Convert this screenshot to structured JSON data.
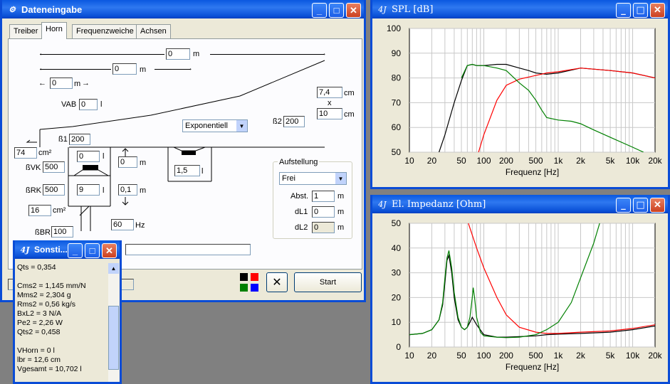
{
  "windows": {
    "input": {
      "title": "Dateneingabe",
      "tabs": [
        "Treiber",
        "Horn",
        "Frequenzweiche",
        "Achsen"
      ],
      "active_tab": "Horn",
      "fields": {
        "len_total": "0",
        "len_total_unit": "m",
        "len_2": "0",
        "len_2_unit": "m",
        "len_3": "0",
        "len_3_unit": "m",
        "vab_label": "VAB",
        "vab": "0",
        "vab_unit": "l",
        "w1": "7,4",
        "w1_unit": "cm",
        "times": "x",
        "w2": "10",
        "w2_unit": "cm",
        "beta2_label": "ß2",
        "beta2": "200",
        "horn_type": "Exponentiell",
        "beta1_label": "ß1",
        "beta1": "200",
        "area1": "74",
        "area1_unit": "cm²",
        "vol_l": "0",
        "vol_l_unit": "l",
        "bvk_label": "ßVK",
        "bvk": "500",
        "brk_label": "ßRK",
        "brk": "500",
        "dist1": "0",
        "dist1_unit": "m",
        "dist2": "0,1",
        "dist2_unit": "m",
        "vol2": "9",
        "vol2_unit": "l",
        "vol3": "1,5",
        "vol3_unit": "l",
        "area2": "16",
        "area2_unit": "cm²",
        "bbr_label": "ßBR",
        "bbr": "100",
        "freq": "60",
        "freq_unit": "Hz"
      },
      "aufstellung": {
        "legend": "Aufstellung",
        "mode": "Frei",
        "abst_label": "Abst.",
        "abst": "1",
        "abst_unit": "m",
        "dl1_label": "dL1",
        "dl1": "0",
        "dl1_unit": "m",
        "dl2_label": "dL2",
        "dl2": "0",
        "dl2_unit": "m"
      },
      "start_label": "Start",
      "colors": [
        "#000000",
        "#ff0000",
        "#008000",
        "#0000ff"
      ]
    },
    "sonst": {
      "title": "Sonsti...",
      "lines": [
        "Qts = 0,354",
        "",
        "Cms2 = 1,145 mm/N",
        "Mms2 = 2,304 g",
        "Rms2 = 0,56 kg/s",
        "BxL2 = 3 N/A",
        "Pe2 = 2,26 W",
        "Qts2 = 0,458",
        "",
        "VHorn = 0 l",
        "lbr = 12,6 cm",
        "Vgesamt = 10,702 l"
      ]
    },
    "spl": {
      "title": "SPL [dB]"
    },
    "imp": {
      "title": "El. Impedanz [Ohm]"
    }
  },
  "chart_data": [
    {
      "type": "line",
      "title": "SPL [dB]",
      "xlabel": "Frequenz [Hz]",
      "ylabel": "",
      "xscale": "log",
      "xlim": [
        10,
        20000
      ],
      "ylim": [
        50,
        100
      ],
      "xticks": [
        10,
        20,
        50,
        100,
        200,
        500,
        1000,
        2000,
        5000,
        10000,
        20000
      ],
      "xticklabels": [
        "10",
        "20",
        "50",
        "100",
        "200",
        "500",
        "1k",
        "2k",
        "5k",
        "10k",
        "20k"
      ],
      "yticks": [
        50,
        60,
        70,
        80,
        90,
        100
      ],
      "grid": true,
      "series": [
        {
          "color": "#000000",
          "x": [
            25,
            30,
            40,
            50,
            60,
            70,
            80,
            100,
            150,
            200,
            300,
            400,
            500,
            700,
            1000,
            2000,
            5000,
            10000,
            20000
          ],
          "y": [
            50,
            57,
            70,
            79,
            85,
            85.5,
            85,
            85,
            85.5,
            85.5,
            84,
            83,
            82,
            81.5,
            82,
            84,
            83,
            82,
            80
          ]
        },
        {
          "color": "#ff0000",
          "x": [
            85,
            100,
            150,
            200,
            300,
            500,
            700,
            1000,
            2000,
            5000,
            10000,
            20000
          ],
          "y": [
            50,
            57,
            71,
            77,
            79.5,
            81,
            82,
            82.5,
            84,
            83,
            82,
            80
          ]
        },
        {
          "color": "#008000",
          "x": [
            50,
            60,
            70,
            80,
            100,
            150,
            200,
            300,
            400,
            500,
            600,
            700,
            1000,
            1500,
            2000,
            3000,
            5000,
            10000,
            14000
          ],
          "y": [
            80,
            85,
            85.5,
            85,
            85,
            84,
            83,
            78,
            75,
            71,
            67,
            64,
            63,
            62.5,
            61.5,
            59,
            56,
            52,
            50
          ]
        }
      ]
    },
    {
      "type": "line",
      "title": "El. Impedanz [Ohm]",
      "xlabel": "Frequenz [Hz]",
      "ylabel": "",
      "xscale": "log",
      "xlim": [
        10,
        20000
      ],
      "ylim": [
        0,
        50
      ],
      "xticks": [
        10,
        20,
        50,
        100,
        200,
        500,
        1000,
        2000,
        5000,
        10000,
        20000
      ],
      "xticklabels": [
        "10",
        "20",
        "50",
        "100",
        "200",
        "500",
        "1k",
        "2k",
        "5k",
        "10k",
        "20k"
      ],
      "yticks": [
        0,
        10,
        20,
        30,
        40,
        50
      ],
      "grid": true,
      "series": [
        {
          "color": "#000000",
          "x": [
            10,
            15,
            20,
            25,
            28,
            30,
            32,
            34,
            37,
            40,
            45,
            50,
            55,
            60,
            65,
            70,
            80,
            100,
            150,
            200,
            300,
            500,
            700,
            1000,
            2000,
            5000,
            10000,
            20000
          ],
          "y": [
            5,
            5.5,
            7,
            11,
            17,
            26,
            35,
            37,
            30,
            20,
            11,
            8,
            7,
            8,
            10,
            12,
            9,
            5,
            4,
            4,
            4.2,
            4.5,
            5,
            5.2,
            5.5,
            6,
            7,
            8.5
          ]
        },
        {
          "color": "#ff0000",
          "x": [
            62,
            80,
            100,
            150,
            200,
            300,
            500,
            700,
            1000,
            2000,
            5000,
            10000,
            20000
          ],
          "y": [
            50,
            40,
            32,
            20,
            13,
            8,
            6,
            5.5,
            5.5,
            6,
            6.5,
            7.5,
            9
          ]
        },
        {
          "color": "#008000",
          "x": [
            10,
            15,
            20,
            25,
            28,
            30,
            32,
            34,
            37,
            40,
            45,
            50,
            55,
            60,
            65,
            70,
            72,
            75,
            80,
            90,
            100,
            150,
            200,
            300,
            500,
            700,
            1000,
            1500,
            2000,
            3000,
            3600
          ],
          "y": [
            5,
            5.5,
            7,
            11,
            18,
            28,
            36,
            39,
            32,
            22,
            12,
            8,
            7,
            8,
            12,
            20,
            24,
            20,
            12,
            6,
            4.5,
            4,
            3.8,
            4,
            5,
            7,
            10,
            18,
            28,
            42,
            50
          ]
        }
      ]
    }
  ]
}
